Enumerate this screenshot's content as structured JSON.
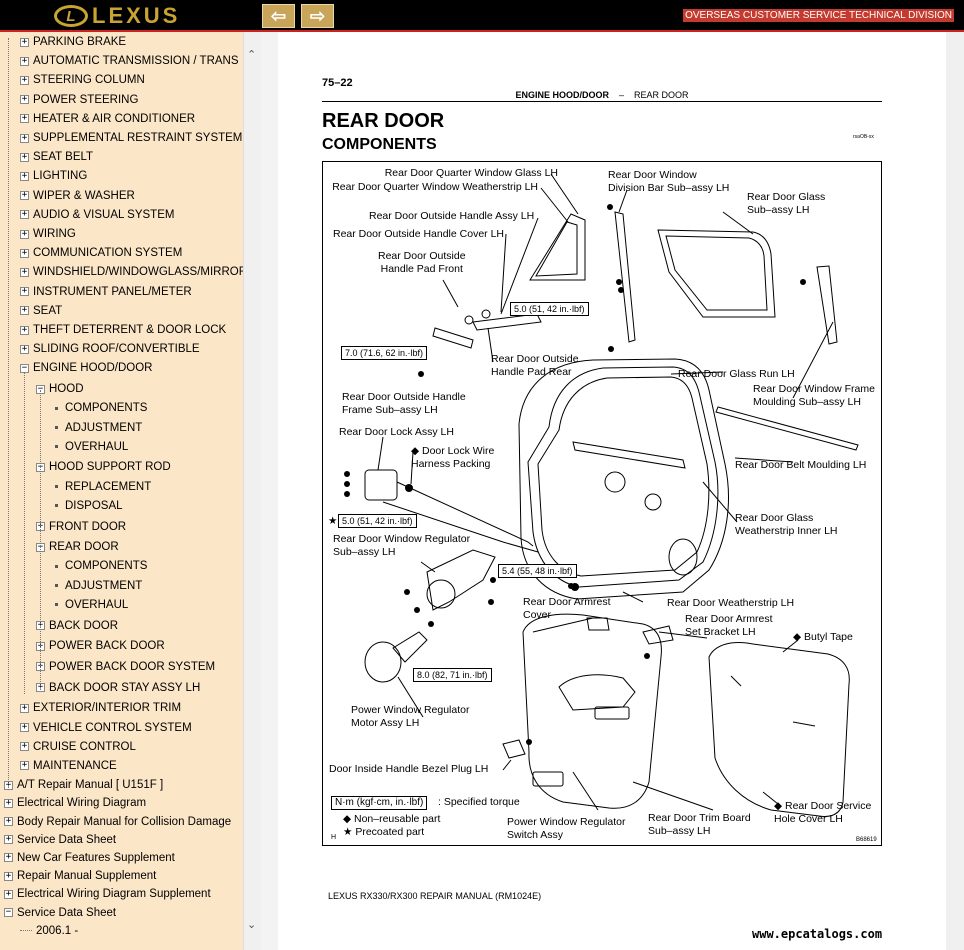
{
  "header": {
    "logo_text": "LEXUS",
    "division": "OVERSEAS CUSTOMER SERVICE TECHNICAL DIVISION",
    "back_icon": "arrow-left-icon",
    "forward_icon": "arrow-right-icon"
  },
  "sidebar": {
    "items": [
      {
        "label": "PARKING BRAKE",
        "level": 1,
        "kind": "plus"
      },
      {
        "label": "AUTOMATIC TRANSMISSION / TRANS",
        "level": 1,
        "kind": "plus"
      },
      {
        "label": "STEERING COLUMN",
        "level": 1,
        "kind": "plus"
      },
      {
        "label": "POWER STEERING",
        "level": 1,
        "kind": "plus"
      },
      {
        "label": "HEATER & AIR CONDITIONER",
        "level": 1,
        "kind": "plus"
      },
      {
        "label": "SUPPLEMENTAL RESTRAINT SYSTEM",
        "level": 1,
        "kind": "plus"
      },
      {
        "label": "SEAT BELT",
        "level": 1,
        "kind": "plus"
      },
      {
        "label": "LIGHTING",
        "level": 1,
        "kind": "plus"
      },
      {
        "label": "WIPER & WASHER",
        "level": 1,
        "kind": "plus"
      },
      {
        "label": "AUDIO & VISUAL SYSTEM",
        "level": 1,
        "kind": "plus"
      },
      {
        "label": "WIRING",
        "level": 1,
        "kind": "plus"
      },
      {
        "label": "COMMUNICATION SYSTEM",
        "level": 1,
        "kind": "plus"
      },
      {
        "label": "WINDSHIELD/WINDOWGLASS/MIRROR",
        "level": 1,
        "kind": "plus"
      },
      {
        "label": "INSTRUMENT PANEL/METER",
        "level": 1,
        "kind": "plus"
      },
      {
        "label": "SEAT",
        "level": 1,
        "kind": "plus"
      },
      {
        "label": "THEFT DETERRENT & DOOR LOCK",
        "level": 1,
        "kind": "plus"
      },
      {
        "label": "SLIDING ROOF/CONVERTIBLE",
        "level": 1,
        "kind": "plus"
      },
      {
        "label": "ENGINE HOOD/DOOR",
        "level": 1,
        "kind": "minus"
      },
      {
        "label": "HOOD",
        "level": 2,
        "kind": "minus"
      },
      {
        "label": "COMPONENTS",
        "level": 3,
        "kind": "leaf"
      },
      {
        "label": "ADJUSTMENT",
        "level": 3,
        "kind": "leaf"
      },
      {
        "label": "OVERHAUL",
        "level": 3,
        "kind": "leaf"
      },
      {
        "label": "HOOD SUPPORT ROD",
        "level": 2,
        "kind": "minus"
      },
      {
        "label": "REPLACEMENT",
        "level": 3,
        "kind": "leaf"
      },
      {
        "label": "DISPOSAL",
        "level": 3,
        "kind": "leaf"
      },
      {
        "label": "FRONT DOOR",
        "level": 2,
        "kind": "plus"
      },
      {
        "label": "REAR DOOR",
        "level": 2,
        "kind": "minus"
      },
      {
        "label": "COMPONENTS",
        "level": 3,
        "kind": "leaf"
      },
      {
        "label": "ADJUSTMENT",
        "level": 3,
        "kind": "leaf"
      },
      {
        "label": "OVERHAUL",
        "level": 3,
        "kind": "leaf"
      },
      {
        "label": "BACK DOOR",
        "level": 2,
        "kind": "plus"
      },
      {
        "label": "POWER BACK DOOR",
        "level": 2,
        "kind": "plus"
      },
      {
        "label": "POWER BACK DOOR SYSTEM",
        "level": 2,
        "kind": "plus"
      },
      {
        "label": "BACK DOOR STAY ASSY LH",
        "level": 2,
        "kind": "plus"
      },
      {
        "label": "EXTERIOR/INTERIOR TRIM",
        "level": 1,
        "kind": "plus"
      },
      {
        "label": "VEHICLE CONTROL SYSTEM",
        "level": 1,
        "kind": "plus"
      },
      {
        "label": "CRUISE CONTROL",
        "level": 1,
        "kind": "plus"
      },
      {
        "label": "MAINTENANCE",
        "level": 1,
        "kind": "plus"
      },
      {
        "label": "A/T Repair Manual [ U151F ]",
        "level": 0,
        "kind": "plus"
      },
      {
        "label": "Electrical Wiring Diagram",
        "level": 0,
        "kind": "plus"
      },
      {
        "label": "Body Repair Manual for Collision Damage",
        "level": 0,
        "kind": "plus"
      },
      {
        "label": "Service Data Sheet",
        "level": 0,
        "kind": "plus"
      },
      {
        "label": "New Car Features Supplement",
        "level": 0,
        "kind": "plus"
      },
      {
        "label": "Repair Manual Supplement",
        "level": 0,
        "kind": "plus"
      },
      {
        "label": "Electrical Wiring Diagram Supplement",
        "level": 0,
        "kind": "plus"
      },
      {
        "label": "Service Data Sheet",
        "level": 0,
        "kind": "minus"
      },
      {
        "label": "2006.1 -",
        "level": 1,
        "kind": "leafline"
      }
    ]
  },
  "document": {
    "page_number": "75–22",
    "running_head_left": "ENGINE HOOD/DOOR",
    "running_head_sep": "–",
    "running_head_right": "REAR DOOR",
    "title": "REAR DOOR",
    "subtitle": "COMPONENTS",
    "figure_code": "rsaOB-xx",
    "figure_id": "B68619",
    "footer": "LEXUS RX330/RX300 REPAIR MANUAL   (RM1024E)"
  },
  "figure_labels": [
    {
      "id": "l1",
      "text": "Rear Door Quarter Window Glass LH"
    },
    {
      "id": "l2",
      "text": "Rear Door Quarter Window Weatherstrip LH"
    },
    {
      "id": "l3",
      "text": "Rear Door Window\nDivision Bar Sub–assy LH"
    },
    {
      "id": "l4",
      "text": "Rear Door Glass\nSub–assy LH"
    },
    {
      "id": "l5",
      "text": "Rear Door Outside Handle Assy LH"
    },
    {
      "id": "l6",
      "text": "Rear Door Outside Handle Cover LH"
    },
    {
      "id": "l7",
      "text": "Rear Door Outside\nHandle Pad Front"
    },
    {
      "id": "l8",
      "text": "Rear Door Outside\nHandle Pad Rear"
    },
    {
      "id": "l9",
      "text": "Rear Door Glass Run LH"
    },
    {
      "id": "l10",
      "text": "Rear Door Window Frame\nMoulding Sub–assy LH"
    },
    {
      "id": "l11",
      "text": "Rear Door Outside Handle\nFrame Sub–assy LH"
    },
    {
      "id": "l12",
      "text": "Rear Door Lock Assy LH"
    },
    {
      "id": "l13",
      "text": "◆ Door Lock Wire\nHarness Packing"
    },
    {
      "id": "l14",
      "text": "Rear Door Belt Moulding LH"
    },
    {
      "id": "l15",
      "text": "Rear Door Glass\nWeatherstrip Inner LH"
    },
    {
      "id": "l16",
      "text": "Rear Door Window Regulator\nSub–assy LH"
    },
    {
      "id": "l17",
      "text": "Rear Door Weatherstrip LH"
    },
    {
      "id": "l18",
      "text": "Rear Door Armrest\nCover"
    },
    {
      "id": "l19",
      "text": "Rear Door Armrest\nSet Bracket LH"
    },
    {
      "id": "l20",
      "text": "◆ Butyl Tape"
    },
    {
      "id": "l21",
      "text": "Power Window Regulator\nMotor Assy LH"
    },
    {
      "id": "l22",
      "text": "Door Inside Handle Bezel Plug LH"
    },
    {
      "id": "l23",
      "text": "Power Window Regulator\nSwitch Assy"
    },
    {
      "id": "l24",
      "text": "Rear Door Trim Board\nSub–assy LH"
    },
    {
      "id": "l25",
      "text": "◆ Rear Door Service\nHole Cover LH"
    }
  ],
  "torque_boxes": [
    {
      "id": "t1",
      "text": "5.0 (51, 42 in.·lbf)"
    },
    {
      "id": "t2",
      "text": "7.0 (71.6, 62 in.·lbf)"
    },
    {
      "id": "t3",
      "text": "5.0 (51, 42 in.·lbf)"
    },
    {
      "id": "t4",
      "text": "5.4 (55, 48 in.·lbf)"
    },
    {
      "id": "t5",
      "text": "8.0 (82, 71 in.·lbf)"
    }
  ],
  "legend": {
    "unit_box": "N·m (kgf·cm, in.·lbf)",
    "unit_text": ": Specified torque",
    "nonreusable": "◆  Non–reusable part",
    "precoated": "★  Precoated part",
    "star": "★",
    "h": "H"
  },
  "watermark": "www.epcatalogs.com"
}
